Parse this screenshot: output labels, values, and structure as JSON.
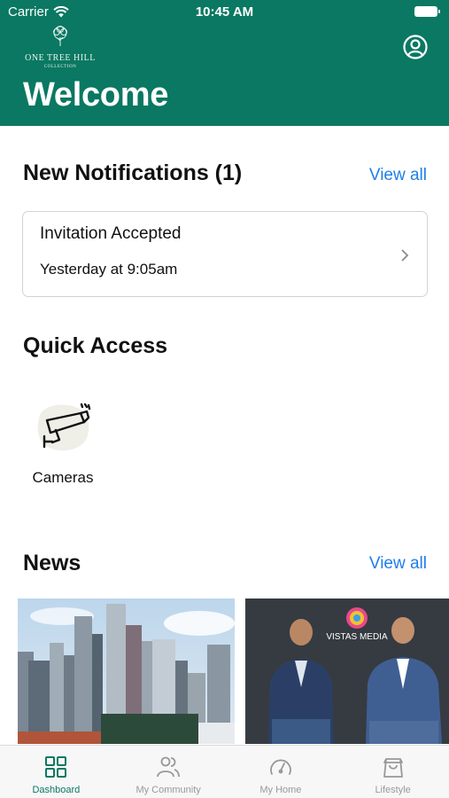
{
  "status_bar": {
    "carrier": "Carrier",
    "time": "10:45 AM"
  },
  "header": {
    "logo_name": "ONE TREE HILL",
    "logo_sub": "COLLECTION",
    "title": "Welcome"
  },
  "notifications": {
    "title": "New Notifications (1)",
    "view_all": "View all",
    "items": [
      {
        "title": "Invitation Accepted",
        "time": "Yesterday at 9:05am"
      }
    ]
  },
  "quick_access": {
    "title": "Quick Access",
    "items": [
      {
        "label": "Cameras",
        "icon": "camera-icon"
      }
    ]
  },
  "news": {
    "title": "News",
    "view_all": "View all",
    "items": [
      {
        "image": "city-skyline"
      },
      {
        "image": "two-men-vistas-media",
        "brand_text": "VISTAS MEDIA"
      }
    ]
  },
  "tabbar": {
    "items": [
      {
        "label": "Dashboard",
        "icon": "dashboard-icon",
        "active": true
      },
      {
        "label": "My Community",
        "icon": "community-icon",
        "active": false
      },
      {
        "label": "My Home",
        "icon": "gauge-icon",
        "active": false
      },
      {
        "label": "Lifestyle",
        "icon": "bag-icon",
        "active": false
      }
    ]
  },
  "colors": {
    "brand": "#0a7862",
    "link": "#1f7ee8",
    "tab_inactive": "#999999"
  }
}
